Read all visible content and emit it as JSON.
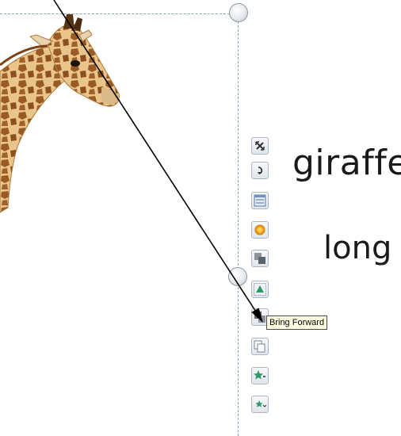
{
  "slide": {
    "line1": "giraffe",
    "line2": "long"
  },
  "toolbar": {
    "buttons": [
      {
        "name": "reset-picture-icon"
      },
      {
        "name": "rotate-icon"
      },
      {
        "name": "picture-styles-icon"
      },
      {
        "name": "picture-effects-icon"
      },
      {
        "name": "send-backward-icon"
      },
      {
        "name": "position-icon"
      },
      {
        "name": "bring-forward-icon"
      },
      {
        "name": "group-icon"
      },
      {
        "name": "shape-fill-icon"
      },
      {
        "name": "shape-outline-icon"
      }
    ]
  },
  "tooltip": {
    "text": "Bring Forward"
  },
  "colors": {
    "selection": "#8aa3b4",
    "tooltip_bg": "#ffffe1",
    "giraffe": "#c98a3b",
    "green_icon": "#2e9a6a"
  }
}
